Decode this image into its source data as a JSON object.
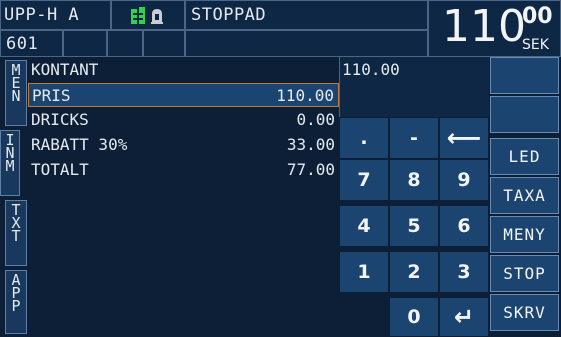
{
  "header": {
    "mode": "UPP-H A",
    "status": "STOPPAD",
    "car_number": "601",
    "amount_main": "110",
    "amount_cents": "00",
    "currency": "SEK"
  },
  "side_tabs": [
    {
      "label": "MEN"
    },
    {
      "label": "INM"
    },
    {
      "label": "TXT"
    },
    {
      "label": "APP"
    }
  ],
  "payment": {
    "method": "KONTANT",
    "entry_value": "110.00",
    "rows": [
      {
        "label": "PRIS",
        "value": "110.00"
      },
      {
        "label": "DRICKS",
        "value": "0.00"
      },
      {
        "label": "RABATT 30%",
        "value": "33.00"
      },
      {
        "label": "TOTALT",
        "value": "77.00"
      }
    ]
  },
  "keypad": {
    "dot": ".",
    "minus": "-",
    "backspace": "⟵",
    "k7": "7",
    "k8": "8",
    "k9": "9",
    "k4": "4",
    "k5": "5",
    "k6": "6",
    "k1": "1",
    "k2": "2",
    "k3": "3",
    "k0": "0",
    "enter": "↵"
  },
  "right_buttons": [
    "LED",
    "TAXA",
    "MENY",
    "STOP",
    "SKRV"
  ],
  "colors": {
    "background": "#0c1f36",
    "button": "#1b4570",
    "selected_border": "#c07a3a",
    "indicator_green": "#2fd44a"
  }
}
